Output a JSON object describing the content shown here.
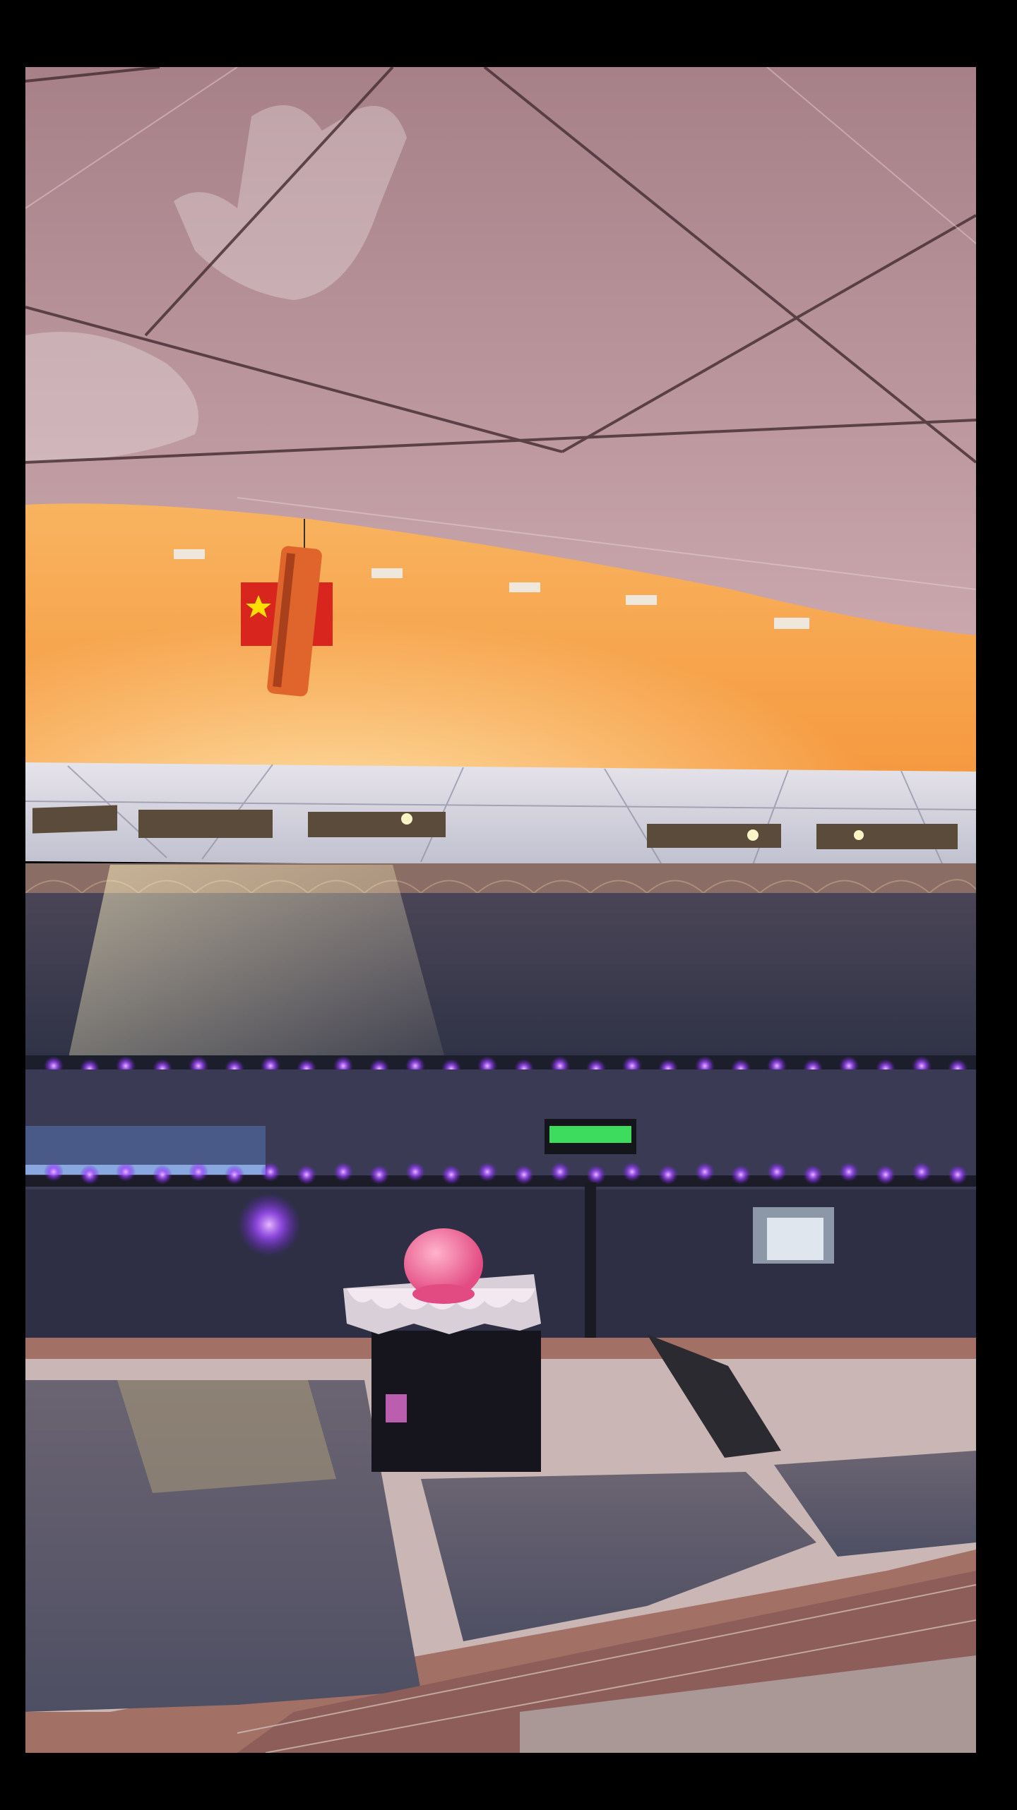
{
  "scene": {
    "subject": "stadium-concert-at-sunset",
    "colors": {
      "background": "#000000",
      "sky_top": "#f7c98a",
      "sky_mid": "#fbb25a",
      "sky_bottom": "#f79a3a",
      "roof": "#c8a0a6",
      "roof_dark": "#8e6a72",
      "crowd": "#3b3d52",
      "floor_crowd": "#5a5a6e",
      "track": "#a0706a",
      "purple_light": "#b15cff",
      "pink_balloon": "#f06a96",
      "screen_green": "#45ff6a",
      "flag_red": "#d8261e"
    },
    "elements": [
      "roof-canopy",
      "flag-icon",
      "speaker-array",
      "sunset-sky",
      "upper-stands",
      "purple-lights",
      "stage",
      "pink-balloon",
      "floor-crowd",
      "running-track"
    ]
  }
}
